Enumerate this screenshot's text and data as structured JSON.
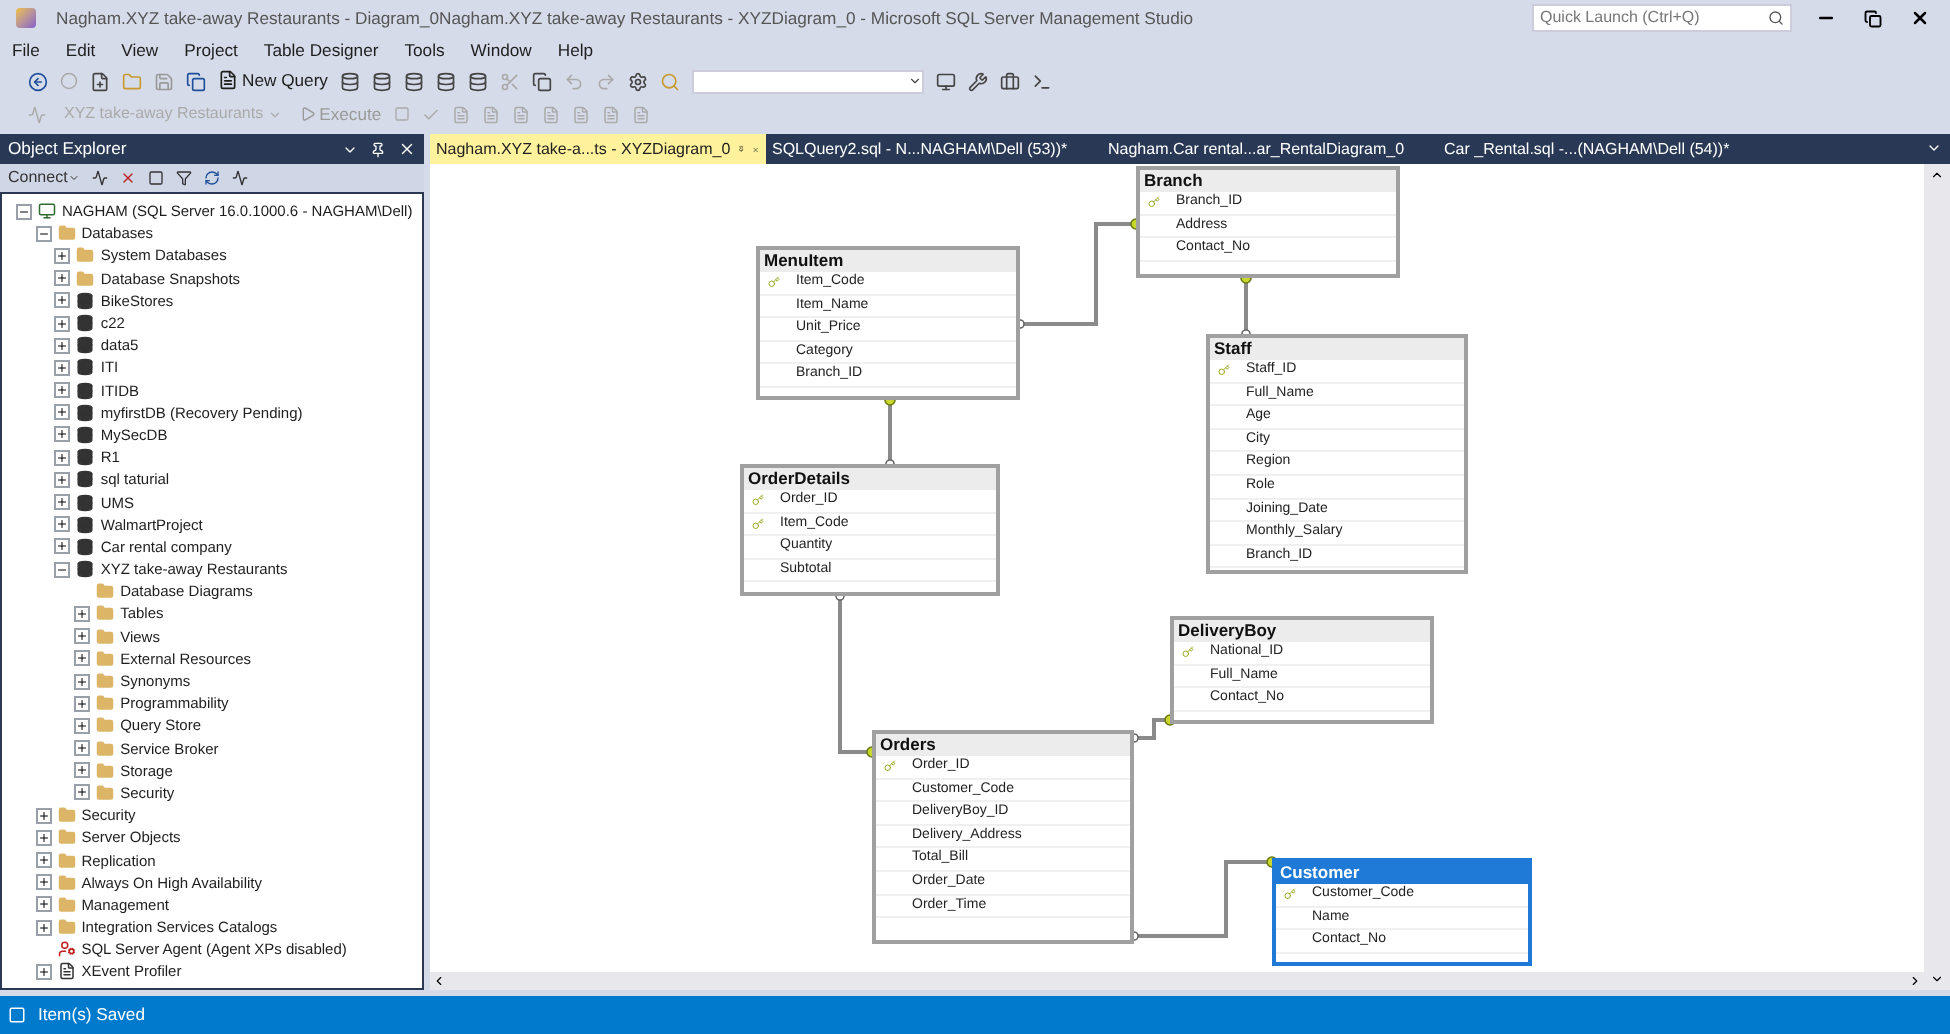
{
  "window": {
    "title": "Nagham.XYZ take-away Restaurants - Diagram_0Nagham.XYZ take-away Restaurants - XYZDiagram_0 - Microsoft SQL Server Management Studio",
    "quick_launch": {
      "placeholder": "Quick Launch (Ctrl+Q)"
    }
  },
  "menu": [
    "File",
    "Edit",
    "View",
    "Project",
    "Table Designer",
    "Tools",
    "Window",
    "Help"
  ],
  "toolbar": {
    "new_query": "New Query",
    "database": "XYZ take-away Restaurants",
    "execute": "Execute"
  },
  "object_explorer": {
    "title": "Object Explorer",
    "connect": "Connect",
    "tree": [
      {
        "label": "NAGHAM (SQL Server 16.0.1000.6 - NAGHAM\\Dell)",
        "kind": "server",
        "expanded": true,
        "children": [
          {
            "label": "Databases",
            "kind": "folder",
            "expanded": true,
            "children": [
              {
                "label": "System Databases",
                "kind": "folder",
                "expanded": false
              },
              {
                "label": "Database Snapshots",
                "kind": "folder",
                "expanded": false
              },
              {
                "label": "BikeStores",
                "kind": "database",
                "expanded": false
              },
              {
                "label": "c22",
                "kind": "database",
                "expanded": false
              },
              {
                "label": "data5",
                "kind": "database",
                "expanded": false
              },
              {
                "label": "ITI",
                "kind": "database",
                "expanded": false
              },
              {
                "label": "ITIDB",
                "kind": "database",
                "expanded": false
              },
              {
                "label": "myfirstDB (Recovery Pending)",
                "kind": "database",
                "expanded": false
              },
              {
                "label": "MySecDB",
                "kind": "database",
                "expanded": false
              },
              {
                "label": "R1",
                "kind": "database",
                "expanded": false
              },
              {
                "label": "sql taturial",
                "kind": "database",
                "expanded": false
              },
              {
                "label": "UMS",
                "kind": "database",
                "expanded": false
              },
              {
                "label": "WalmartProject",
                "kind": "database",
                "expanded": false
              },
              {
                "label": "Car rental company",
                "kind": "database",
                "expanded": false
              },
              {
                "label": "XYZ take-away Restaurants",
                "kind": "database",
                "expanded": true,
                "children": [
                  {
                    "label": "Database Diagrams",
                    "kind": "folder"
                  },
                  {
                    "label": "Tables",
                    "kind": "folder",
                    "expanded": false
                  },
                  {
                    "label": "Views",
                    "kind": "folder",
                    "expanded": false
                  },
                  {
                    "label": "External Resources",
                    "kind": "folder",
                    "expanded": false
                  },
                  {
                    "label": "Synonyms",
                    "kind": "folder",
                    "expanded": false
                  },
                  {
                    "label": "Programmability",
                    "kind": "folder",
                    "expanded": false
                  },
                  {
                    "label": "Query Store",
                    "kind": "folder",
                    "expanded": false
                  },
                  {
                    "label": "Service Broker",
                    "kind": "folder",
                    "expanded": false
                  },
                  {
                    "label": "Storage",
                    "kind": "folder",
                    "expanded": false
                  },
                  {
                    "label": "Security",
                    "kind": "folder",
                    "expanded": false
                  }
                ]
              }
            ]
          },
          {
            "label": "Security",
            "kind": "folder",
            "expanded": false
          },
          {
            "label": "Server Objects",
            "kind": "folder",
            "expanded": false
          },
          {
            "label": "Replication",
            "kind": "folder",
            "expanded": false
          },
          {
            "label": "Always On High Availability",
            "kind": "folder",
            "expanded": false
          },
          {
            "label": "Management",
            "kind": "folder",
            "expanded": false
          },
          {
            "label": "Integration Services Catalogs",
            "kind": "folder",
            "expanded": false
          },
          {
            "label": "SQL Server Agent (Agent XPs disabled)",
            "kind": "agent"
          },
          {
            "label": "XEvent Profiler",
            "kind": "profiler",
            "expanded": false
          }
        ]
      }
    ]
  },
  "tabs": [
    {
      "label": "Nagham.XYZ take-a...ts - XYZDiagram_0",
      "selected": true
    },
    {
      "label": "SQLQuery2.sql - N...NAGHAM\\Dell (53))*",
      "selected": false
    },
    {
      "label": "Nagham.Car rental...ar_RentalDiagram_0",
      "selected": false
    },
    {
      "label": "Car _Rental.sql -...(NAGHAM\\Dell (54))*",
      "selected": false
    }
  ],
  "diagram": {
    "tables": [
      {
        "name": "Branch",
        "selected": false,
        "columns": [
          {
            "name": "Branch_ID",
            "primary_key": true
          },
          {
            "name": "Address",
            "primary_key": false
          },
          {
            "name": "Contact_No",
            "primary_key": false
          }
        ]
      },
      {
        "name": "MenuItem",
        "selected": false,
        "columns": [
          {
            "name": "Item_Code",
            "primary_key": true
          },
          {
            "name": "Item_Name",
            "primary_key": false
          },
          {
            "name": "Unit_Price",
            "primary_key": false
          },
          {
            "name": "Category",
            "primary_key": false
          },
          {
            "name": "Branch_ID",
            "primary_key": false
          }
        ]
      },
      {
        "name": "Staff",
        "selected": false,
        "columns": [
          {
            "name": "Staff_ID",
            "primary_key": true
          },
          {
            "name": "Full_Name",
            "primary_key": false
          },
          {
            "name": "Age",
            "primary_key": false
          },
          {
            "name": "City",
            "primary_key": false
          },
          {
            "name": "Region",
            "primary_key": false
          },
          {
            "name": "Role",
            "primary_key": false
          },
          {
            "name": "Joining_Date",
            "primary_key": false
          },
          {
            "name": "Monthly_Salary",
            "primary_key": false
          },
          {
            "name": "Branch_ID",
            "primary_key": false
          }
        ]
      },
      {
        "name": "OrderDetails",
        "selected": false,
        "columns": [
          {
            "name": "Order_ID",
            "primary_key": true
          },
          {
            "name": "Item_Code",
            "primary_key": true
          },
          {
            "name": "Quantity",
            "primary_key": false
          },
          {
            "name": "Subtotal",
            "primary_key": false
          }
        ]
      },
      {
        "name": "DeliveryBoy",
        "selected": false,
        "columns": [
          {
            "name": "National_ID",
            "primary_key": true
          },
          {
            "name": "Full_Name",
            "primary_key": false
          },
          {
            "name": "Contact_No",
            "primary_key": false
          }
        ]
      },
      {
        "name": "Orders",
        "selected": false,
        "columns": [
          {
            "name": "Order_ID",
            "primary_key": true
          },
          {
            "name": "Customer_Code",
            "primary_key": false
          },
          {
            "name": "DeliveryBoy_ID",
            "primary_key": false
          },
          {
            "name": "Delivery_Address",
            "primary_key": false
          },
          {
            "name": "Total_Bill",
            "primary_key": false
          },
          {
            "name": "Order_Date",
            "primary_key": false
          },
          {
            "name": "Order_Time",
            "primary_key": false
          }
        ]
      },
      {
        "name": "Customer",
        "selected": true,
        "columns": [
          {
            "name": "Customer_Code",
            "primary_key": true
          },
          {
            "name": "Name",
            "primary_key": false
          },
          {
            "name": "Contact_No",
            "primary_key": false
          }
        ]
      }
    ]
  },
  "status_bar": {
    "message": "Item(s) Saved"
  }
}
